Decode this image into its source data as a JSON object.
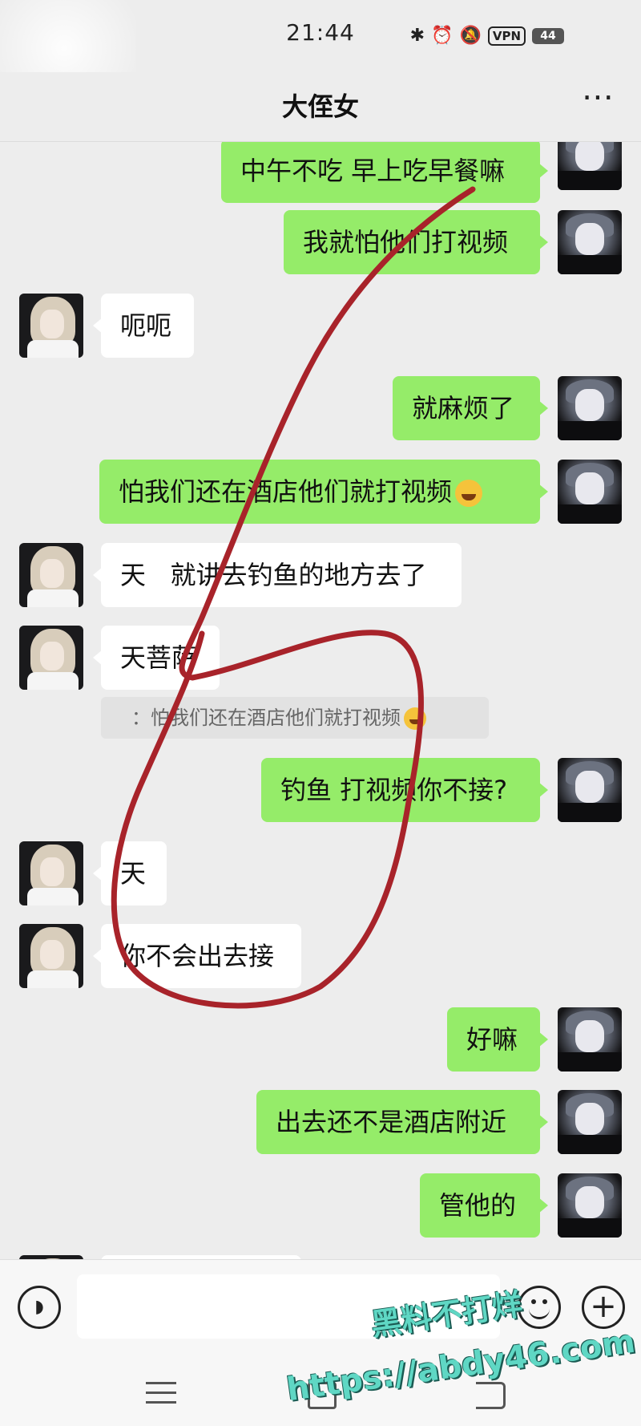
{
  "status_bar": {
    "time": "21:44",
    "vpn": "VPN",
    "battery": "44"
  },
  "header": {
    "title": "大侄女",
    "more_icon": "more-horizontal-icon"
  },
  "messages": [
    {
      "side": "out",
      "text": "中午不吃 早上吃早餐嘛"
    },
    {
      "side": "out",
      "text": "我就怕他们打视频"
    },
    {
      "side": "in",
      "text": "呃呃"
    },
    {
      "side": "out",
      "text": "就麻烦了"
    },
    {
      "side": "out",
      "text": "怕我们还在酒店他们就打视频",
      "emoji": "laugh-cry-emoji"
    },
    {
      "side": "in",
      "text": "天   就讲去钓鱼的地方去了"
    },
    {
      "side": "in",
      "text": "天菩萨"
    },
    {
      "side": "quote",
      "text": "：怕我们还在酒店他们就打视频",
      "emoji": "laugh-cry-emoji"
    },
    {
      "side": "out",
      "text": "钓鱼 打视频你不接?"
    },
    {
      "side": "in",
      "text": "天"
    },
    {
      "side": "in",
      "text": "你不会出去接"
    },
    {
      "side": "out",
      "text": "好嘛"
    },
    {
      "side": "out",
      "text": "出去还不是酒店附近"
    },
    {
      "side": "out",
      "text": "管他的"
    }
  ],
  "input_bar": {
    "voice_icon": "voice-icon",
    "emoji_icon": "emoji-icon",
    "plus_icon": "plus-icon"
  },
  "watermark": {
    "line1": "黑料不打烊",
    "line2": "https://abdy46.com"
  },
  "colors": {
    "outgoing": "#95ec69",
    "incoming": "#ffffff",
    "background": "#ededed",
    "annotation": "#a8232a"
  }
}
